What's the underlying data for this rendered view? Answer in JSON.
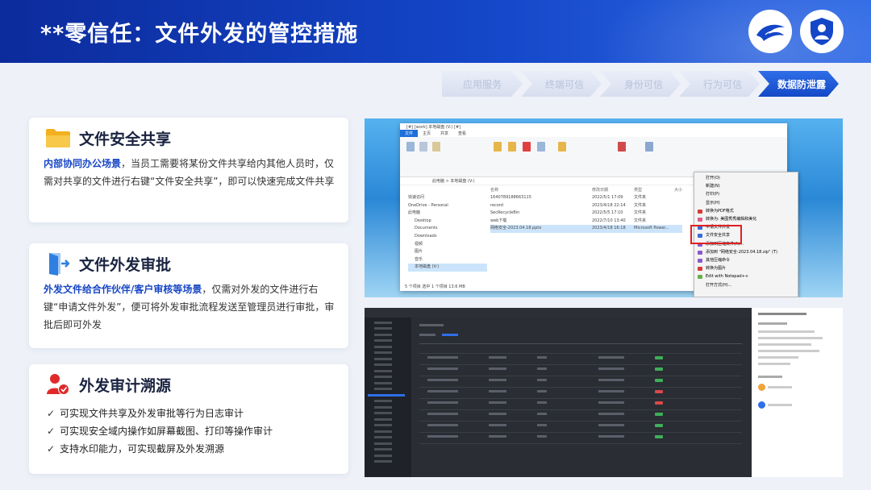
{
  "header": {
    "title": "**零信任：文件外发的管控措施"
  },
  "steps": [
    "应用服务",
    "终端可信",
    "身份可信",
    "行为可信",
    "数据防泄露"
  ],
  "active_step": 4,
  "cards": [
    {
      "icon": "folder-icon",
      "title": "文件安全共享",
      "highlight": "内部协同办公场景",
      "body": "，当员工需要将某份文件共享给内其他人员时，仅需对共享的文件进行右键“文件安全共享”，即可以快速完成文件共享"
    },
    {
      "icon": "door-exit-icon",
      "title": "文件外发审批",
      "highlight": "外发文件给合作伙伴/客户审核等场景",
      "body": "，仅需对外发的文件进行右键“申请文件外发”，便可将外发审批流程发送至管理员进行审批，审批后即可外发"
    },
    {
      "icon": "user-audit-icon",
      "title": "外发审计溯源",
      "items": [
        "可实现文件共享及外发审批等行为日志审计",
        "可实现安全域内操作如屏幕截图、打印等操作审计",
        "支持水印能力，可实现截屏及外发溯源"
      ]
    }
  ],
  "explorer": {
    "window_title": "[#] [work] 本地磁盘 (V:) [#]",
    "tabs": [
      "文件",
      "主页",
      "共享",
      "查看"
    ],
    "address": "此电脑 > 本地磁盘 (V:)",
    "col_name": "名称",
    "col_date": "修改日期",
    "col_type": "类型",
    "col_size": "大小",
    "nav": [
      "快速访问",
      "OneDrive - Personal",
      "此电脑",
      "Desktop",
      "Documents",
      "Downloads",
      "视频",
      "图片",
      "音乐",
      "本地磁盘 (V:)"
    ],
    "files": [
      {
        "name": "1640789188663115",
        "date": "2022/5/1 17:09",
        "type": "文件夹"
      },
      {
        "name": "record",
        "date": "2023/4/18 22:14",
        "type": "文件夹"
      },
      {
        "name": "SecRecycleBin",
        "date": "2022/5/5 17:10",
        "type": "文件夹"
      },
      {
        "name": "web下载",
        "date": "2022/7/10 13:40",
        "type": "文件夹"
      },
      {
        "name": "网络安全-2023.04.18.pptx",
        "date": "2023/4/18 16:18",
        "type": "Microsoft Power..."
      }
    ],
    "status": "5 个项目   选中 1 个项目  13.6 MB",
    "context_menu": [
      "打开(O)",
      "新建(N)",
      "打印(P)",
      "显示(H)",
      "转换为PDF格式",
      "转换为: 美图秀秀编辑和美化",
      "申请文件外发",
      "文件安全共享",
      "添加到压缩文件(A)...",
      "添加到 \"网络安全-2023.04.18.zip\" (T)",
      "其他压缩命令",
      "转换为图片",
      "Edit with Notepad++",
      "打开方式(H)..."
    ]
  },
  "colors": {
    "brand_blue": "#1446c8",
    "highlight_blue": "#1847c6",
    "redbox": "#e02020"
  }
}
